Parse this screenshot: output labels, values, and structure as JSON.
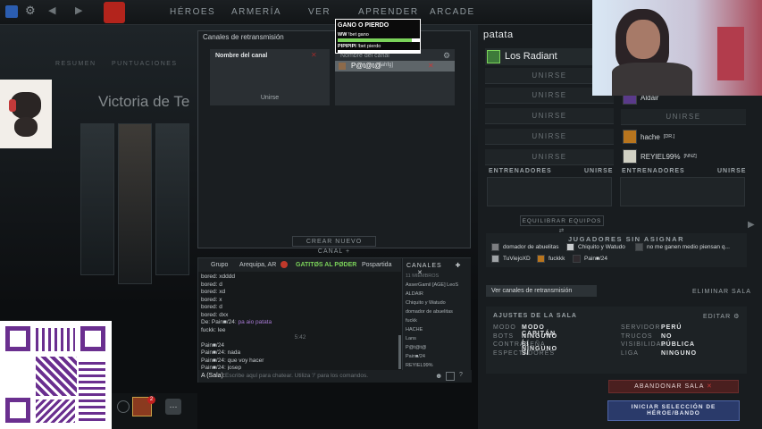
{
  "nav": {
    "items": [
      "HÉROES",
      "ARMERÍA",
      "VER",
      "APRENDER",
      "ARCADE"
    ]
  },
  "poll": {
    "title": "GANO O PIERDO",
    "options": [
      {
        "label": "!bet gano",
        "prefix": "WW"
      },
      {
        "label": "!bet pierdo",
        "prefix": "PIPIPIPI"
      }
    ],
    "result_fraction": 0.9
  },
  "channels": {
    "title": "Canales de retransmisión",
    "column_left_header": "Nombre del canal",
    "column_right_header": "Nombre del canal",
    "join_label": "Unirse",
    "row_name": "P@t@t@",
    "row_tag": "[ahfg]",
    "create_label": "CREAR NUEVO CANAL"
  },
  "chat": {
    "tabs": [
      "Grupo",
      "Arequipa, AR",
      "GATITØS AL PØDER",
      "Pospartida"
    ],
    "lines": [
      {
        "who": "bored",
        "text": ": xdddd"
      },
      {
        "who": "bored",
        "text": ": d"
      },
      {
        "who": "bored",
        "text": ": xd"
      },
      {
        "who": "bored",
        "text": ": x"
      },
      {
        "who": "bored",
        "text": ": d"
      },
      {
        "who": "bored",
        "text": ": dxx"
      },
      {
        "who": "De: Pain■/24",
        "text": ": pa aio patata"
      },
      {
        "who": "fuckk",
        "text": ": lee"
      }
    ],
    "time_marker": "5:42",
    "lines2": [
      {
        "who": "Pain■/24",
        "text": ""
      },
      {
        "who": "Pain■/24",
        "text": ": nada"
      },
      {
        "who": "Pain■/24",
        "text": ": que voy hacer"
      },
      {
        "who": "Pain■/24",
        "text": ": josep"
      }
    ],
    "input_prefix": "A (Sala):",
    "input_placeholder": "Escribe aquí para chatear. Utiliza '/' para los comandos.",
    "channels_title": "CANALES",
    "members_header": "11 MIEMBROS",
    "members": [
      "AsserGamil [AGE] LeoS",
      "ALDAIR",
      "Chiquito y Watudo",
      "domador de abuelitas",
      "fuckk",
      "HACHE",
      "Lans",
      "P@t@t@",
      "Pain■/24",
      "REYIEL99%",
      "TuViejoXD"
    ]
  },
  "lobby": {
    "title": "patata",
    "team": "Los Radiant",
    "join": "UNIRSE",
    "coaches": "ENTRENADORES",
    "players": [
      {
        "name": "Aldair",
        "tag": ""
      },
      {
        "name": "hache",
        "tag": "[DR.]"
      },
      {
        "name": "REYIEL99%",
        "tag": "[NNZ]"
      }
    ],
    "balance": "EQUILIBRAR EQUIPOS",
    "unassigned_title": "JUGADORES SIN ASIGNAR",
    "unassigned": [
      "domador de abuelitas",
      "Chiquito y Watudo",
      "no me ganen medio piensan q...",
      "TuViejoXD",
      "fuckkk",
      "Pain■/24"
    ],
    "view_channels": "Ver canales de retransmisión",
    "delete_room": "ELIMINAR SALA",
    "settings_title": "AJUSTES DE LA SALA",
    "edit": "EDITAR",
    "settings": [
      {
        "k": "MODO",
        "v": "MODO CAPITÁN"
      },
      {
        "k": "BOTS",
        "v": "NINGUNO / NINGUNO"
      },
      {
        "k": "CONTRASEÑA",
        "v": "SÍ"
      },
      {
        "k": "ESPECTADORES",
        "v": "SÍ"
      }
    ],
    "settings_right": [
      {
        "k": "SERVIDOR",
        "v": "PERÚ"
      },
      {
        "k": "TRUCOS",
        "v": "NO"
      },
      {
        "k": "VISIBILIDAD",
        "v": "PÚBLICA"
      },
      {
        "k": "LIGA",
        "v": "NINGUNO"
      }
    ],
    "leave": "ABANDONAR SALA",
    "start_line1": "INICIAR SELECCIÓN DE",
    "start_line2": "HÉROE/BANDO"
  },
  "bg": {
    "tabs": [
      "RESUMEN",
      "PUNTUACIONES"
    ],
    "title": "Victoria de Te"
  },
  "party": {
    "badge": "2"
  },
  "colors": {
    "accent": "#8c1f1f",
    "start_btn": "#2a3a6a",
    "green": "#7bd35a"
  }
}
